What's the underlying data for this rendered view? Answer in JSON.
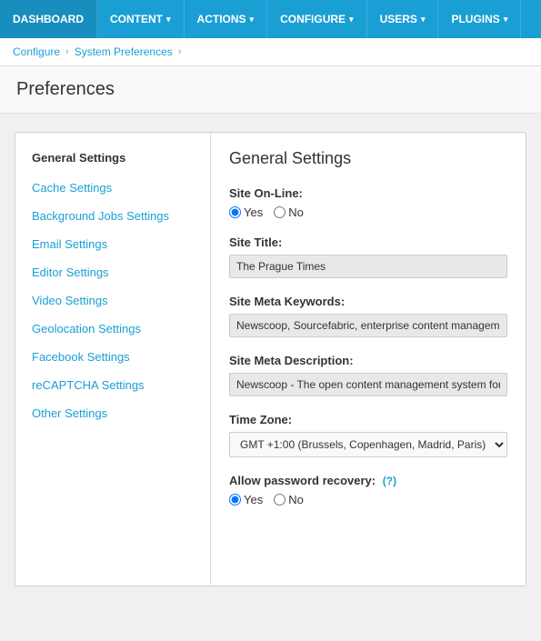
{
  "topnav": {
    "items": [
      {
        "label": "DASHBOARD",
        "hasDropdown": false
      },
      {
        "label": "CONTENT",
        "hasDropdown": true
      },
      {
        "label": "ACTIONS",
        "hasDropdown": true
      },
      {
        "label": "CONFIGURE",
        "hasDropdown": true
      },
      {
        "label": "USERS",
        "hasDropdown": true
      },
      {
        "label": "PLUGINS",
        "hasDropdown": true
      }
    ]
  },
  "breadcrumb": {
    "items": [
      {
        "label": "Configure",
        "link": true
      },
      {
        "label": "System Preferences",
        "link": true
      }
    ]
  },
  "page": {
    "title": "Preferences"
  },
  "sidebar": {
    "section_title": "General Settings",
    "items": [
      {
        "label": "Cache Settings"
      },
      {
        "label": "Background Jobs Settings"
      },
      {
        "label": "Email Settings"
      },
      {
        "label": "Editor Settings"
      },
      {
        "label": "Video Settings"
      },
      {
        "label": "Geolocation Settings"
      },
      {
        "label": "Facebook Settings"
      },
      {
        "label": "reCAPTCHA Settings"
      },
      {
        "label": "Other Settings"
      }
    ]
  },
  "settings": {
    "title": "General Settings",
    "site_online_label": "Site On-Line:",
    "site_online_yes": "Yes",
    "site_online_no": "No",
    "site_title_label": "Site Title:",
    "site_title_value": "The Prague Times",
    "site_meta_keywords_label": "Site Meta Keywords:",
    "site_meta_keywords_value": "Newscoop, Sourcefabric, enterprise content management, ope",
    "site_meta_description_label": "Site Meta Description:",
    "site_meta_description_value": "Newscoop - The open content management system for profess",
    "timezone_label": "Time Zone:",
    "timezone_value": "GMT +1:00 (Brussels, Copenhagen, Madrid, Paris)",
    "allow_password_label": "Allow password recovery:",
    "allow_password_help": "(?)",
    "allow_password_yes": "Yes",
    "allow_password_no": "No"
  }
}
